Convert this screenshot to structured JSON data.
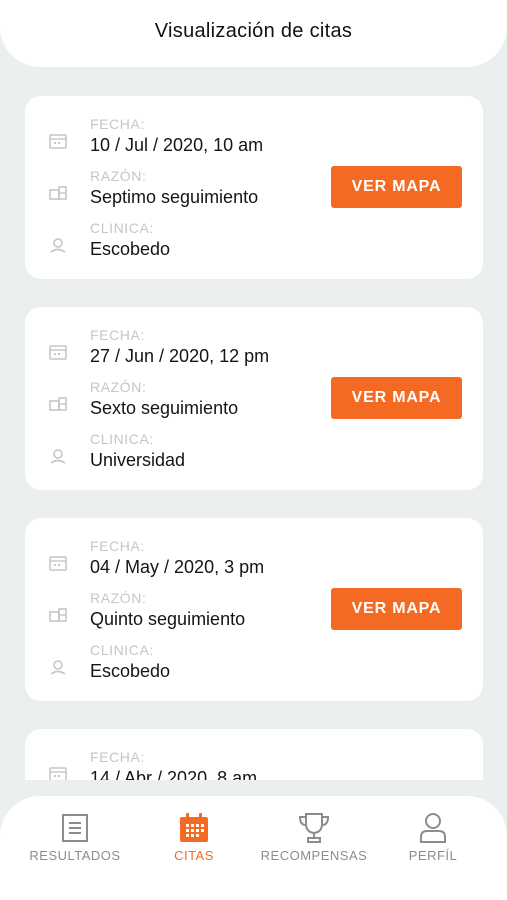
{
  "header": {
    "title": "Visualización de citas"
  },
  "labels": {
    "fecha": "FECHA:",
    "razon": "RAZÓN:",
    "clinica": "CLINICA:"
  },
  "appointments": [
    {
      "fecha": "10 / Jul / 2020, 10 am",
      "razon": "Septimo seguimiento",
      "clinica": "Escobedo",
      "button": "VER MAPA"
    },
    {
      "fecha": "27 / Jun / 2020, 12 pm",
      "razon": "Sexto seguimiento",
      "clinica": "Universidad",
      "button": "VER MAPA"
    },
    {
      "fecha": "04 / May / 2020, 3 pm",
      "razon": "Quinto seguimiento",
      "clinica": "Escobedo",
      "button": "VER MAPA"
    },
    {
      "fecha": "14 / Abr / 2020, 8 am"
    }
  ],
  "tabbar": {
    "items": [
      {
        "label": "RESULTADOS",
        "icon": "list-document-icon",
        "active": false
      },
      {
        "label": "CITAS",
        "icon": "calendar-icon",
        "active": true
      },
      {
        "label": "RECOMPENSAS",
        "icon": "trophy-icon",
        "active": false
      },
      {
        "label": "PERFÍL",
        "icon": "user-icon",
        "active": false
      }
    ]
  },
  "colors": {
    "accent": "#F46A22",
    "background": "#ECEFF0",
    "label_gray": "#C4C6C8",
    "icon_gray": "#8A8D90"
  }
}
